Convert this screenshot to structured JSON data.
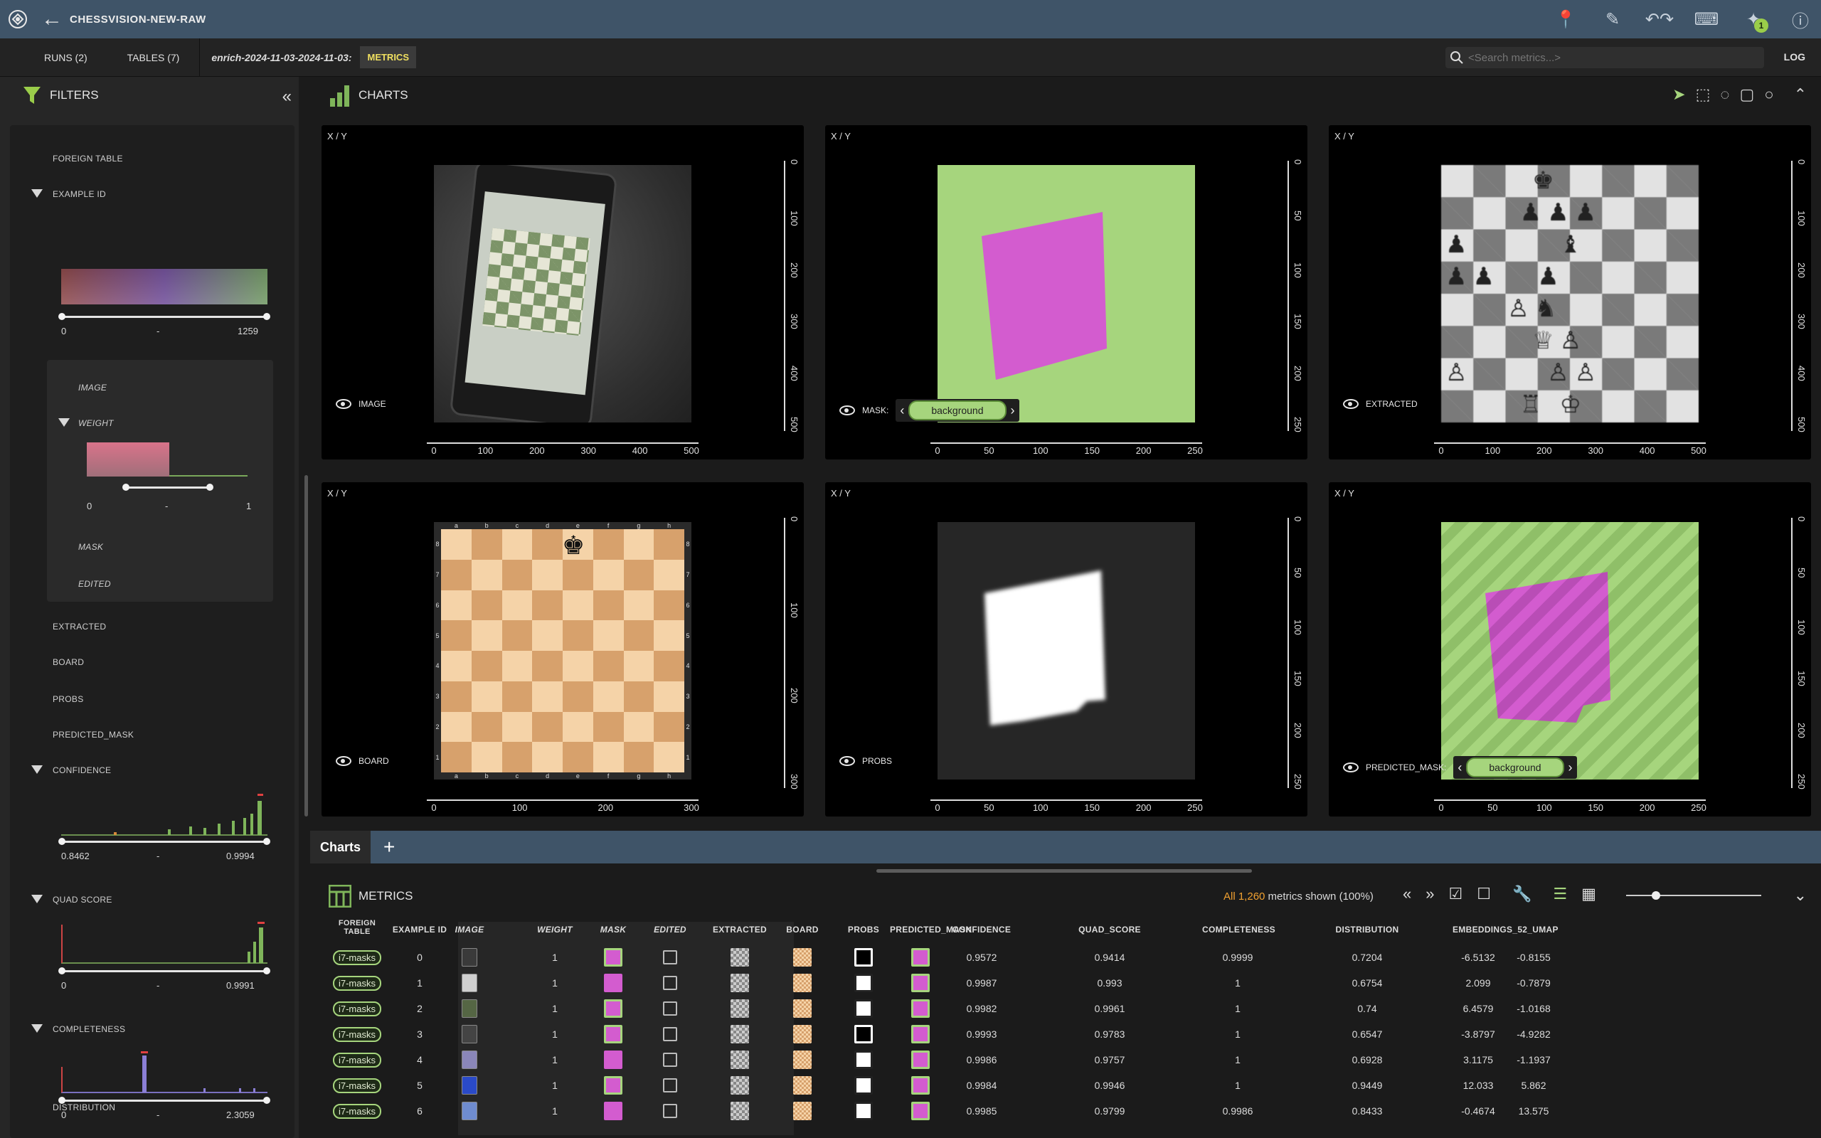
{
  "app": {
    "title": "CHESSVISION-NEW-RAW",
    "notification_count": "1"
  },
  "tabs": {
    "runs": "RUNS (2)",
    "tables": "TABLES (7)",
    "crumb": "enrich-2024-11-03-2024-11-03:",
    "active": "METRICS"
  },
  "search": {
    "placeholder": "<Search metrics...>"
  },
  "log_label": "LOG",
  "filters": {
    "title": "FILTERS",
    "foreign_table": "FOREIGN TABLE",
    "example_id": {
      "label": "EXAMPLE ID",
      "min": "0",
      "dash": "-",
      "max": "1259"
    },
    "image": "IMAGE",
    "weight": {
      "label": "WEIGHT",
      "min": "0",
      "dash": "-",
      "max": "1"
    },
    "mask": "MASK",
    "edited": "EDITED",
    "extracted": "EXTRACTED",
    "board": "BOARD",
    "probs": "PROBS",
    "predicted_mask": "PREDICTED_MASK",
    "confidence": {
      "label": "CONFIDENCE",
      "min": "0.8462",
      "dash": "-",
      "max": "0.9994"
    },
    "quad_score": {
      "label": "QUAD SCORE",
      "min": "0",
      "dash": "-",
      "max": "0.9991"
    },
    "completeness": {
      "label": "COMPLETENESS",
      "min": "0",
      "dash": "-",
      "max": "2.3059"
    },
    "distribution": {
      "label": "DISTRIBUTION"
    }
  },
  "charts": {
    "title": "CHARTS",
    "panels": [
      {
        "axis": "X / Y",
        "label": "IMAGE",
        "xticks": [
          "0",
          "100",
          "200",
          "300",
          "400",
          "500"
        ],
        "yticks": [
          "0",
          "100",
          "200",
          "300",
          "400",
          "500"
        ]
      },
      {
        "axis": "X / Y",
        "label": "MASK:",
        "pill": "background",
        "xticks": [
          "0",
          "50",
          "100",
          "150",
          "200",
          "250"
        ],
        "yticks": [
          "0",
          "50",
          "100",
          "150",
          "200",
          "250"
        ]
      },
      {
        "axis": "X / Y",
        "label": "EXTRACTED",
        "xticks": [
          "0",
          "100",
          "200",
          "300",
          "400",
          "500"
        ],
        "yticks": [
          "0",
          "100",
          "200",
          "300",
          "400",
          "500"
        ]
      },
      {
        "axis": "X / Y",
        "label": "BOARD",
        "xticks": [
          "0",
          "100",
          "200",
          "300"
        ],
        "yticks": [
          "0",
          "100",
          "200",
          "300"
        ]
      },
      {
        "axis": "X / Y",
        "label": "PROBS",
        "xticks": [
          "0",
          "50",
          "100",
          "150",
          "200",
          "250"
        ],
        "yticks": [
          "0",
          "50",
          "100",
          "150",
          "200",
          "250"
        ]
      },
      {
        "axis": "X / Y",
        "label": "PREDICTED_MASK:",
        "pill": "background",
        "xticks": [
          "0",
          "50",
          "100",
          "150",
          "200",
          "250"
        ],
        "yticks": [
          "0",
          "50",
          "100",
          "150",
          "200",
          "250"
        ]
      }
    ],
    "board_files": [
      "a",
      "b",
      "c",
      "d",
      "e",
      "f",
      "g",
      "h"
    ],
    "board_ranks": [
      "8",
      "7",
      "6",
      "5",
      "4",
      "3",
      "2",
      "1"
    ]
  },
  "bottom_tabs": {
    "charts": "Charts",
    "add": "+"
  },
  "metrics": {
    "title": "METRICS",
    "shown_prefix": "All 1,260",
    "shown_suffix": " metrics shown (100%)",
    "columns": [
      "FOREIGN TABLE",
      "EXAMPLE ID",
      "IMAGE",
      "WEIGHT",
      "MASK",
      "EDITED",
      "EXTRACTED",
      "BOARD",
      "PROBS",
      "PREDICTED_MASK",
      "CONFIDENCE",
      "QUAD_SCORE",
      "COMPLETENESS",
      "DISTRIBUTION",
      "EMBEDDINGS_52_UMAP"
    ],
    "rows": [
      {
        "ft": "i7-masks",
        "id": "0",
        "w": "1",
        "conf": "0.9572",
        "quad": "0.9414",
        "comp": "0.9999",
        "dist": "0.7204",
        "e1": "-6.5132",
        "e2": "-0.8155"
      },
      {
        "ft": "i7-masks",
        "id": "1",
        "w": "1",
        "conf": "0.9987",
        "quad": "0.993",
        "comp": "1",
        "dist": "0.6754",
        "e1": "2.099",
        "e2": "-0.7879"
      },
      {
        "ft": "i7-masks",
        "id": "2",
        "w": "1",
        "conf": "0.9982",
        "quad": "0.9961",
        "comp": "1",
        "dist": "0.74",
        "e1": "6.4579",
        "e2": "-1.0168"
      },
      {
        "ft": "i7-masks",
        "id": "3",
        "w": "1",
        "conf": "0.9993",
        "quad": "0.9783",
        "comp": "1",
        "dist": "0.6547",
        "e1": "-3.8797",
        "e2": "-4.9282"
      },
      {
        "ft": "i7-masks",
        "id": "4",
        "w": "1",
        "conf": "0.9986",
        "quad": "0.9757",
        "comp": "1",
        "dist": "0.6928",
        "e1": "3.1175",
        "e2": "-1.1937"
      },
      {
        "ft": "i7-masks",
        "id": "5",
        "w": "1",
        "conf": "0.9984",
        "quad": "0.9946",
        "comp": "1",
        "dist": "0.9449",
        "e1": "12.033",
        "e2": "5.862"
      },
      {
        "ft": "i7-masks",
        "id": "6",
        "w": "1",
        "conf": "0.9985",
        "quad": "0.9799",
        "comp": "0.9986",
        "dist": "0.8433",
        "e1": "-0.4674",
        "e2": "13.575"
      }
    ]
  }
}
